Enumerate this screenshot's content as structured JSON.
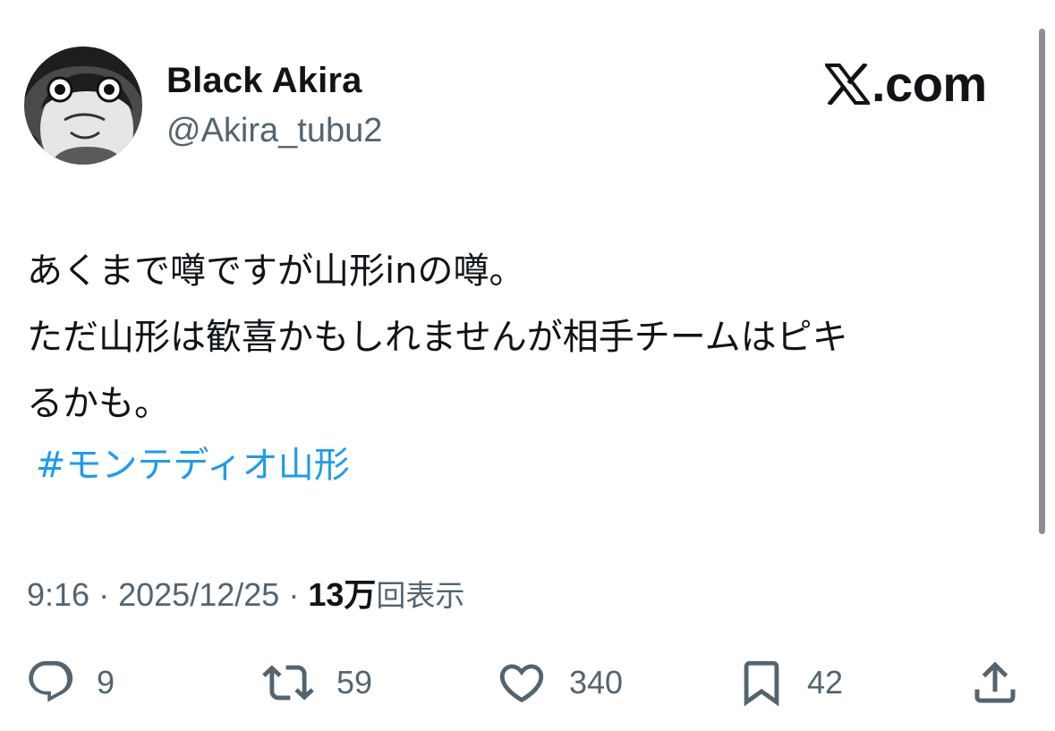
{
  "author": {
    "display_name": "Black Akira",
    "handle": "@Akira_tubu2",
    "avatar_icon": "anime-character-avatar"
  },
  "branding": {
    "logo_icon": "x-logo-icon",
    "domain_suffix": ".com"
  },
  "tweet": {
    "lines": [
      "あくまで噂ですが山形inの噂。",
      "ただ山形は歓喜かもしれませんが相手チームはピキ",
      "るかも。"
    ],
    "hashtag": "#モンテディオ山形"
  },
  "meta": {
    "time": "9:16",
    "separator": "·",
    "date": "2025/12/25",
    "views_count": "13万",
    "views_label": "回表示"
  },
  "actions": {
    "reply_count": "9",
    "repost_count": "59",
    "like_count": "340",
    "bookmark_count": "42"
  },
  "colors": {
    "text": "#0f1419",
    "secondary": "#536471",
    "link": "#1d9bf0"
  }
}
